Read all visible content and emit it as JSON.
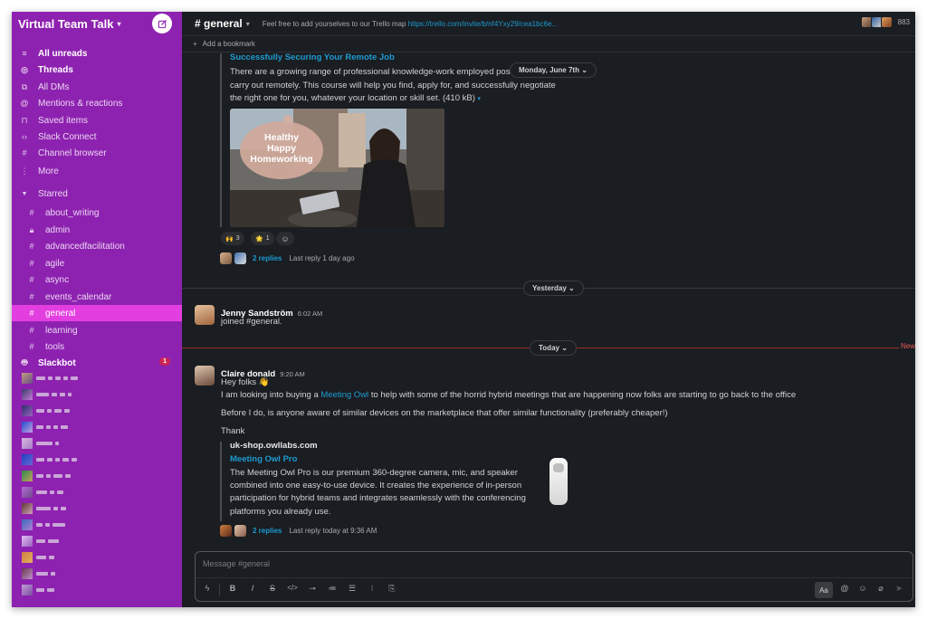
{
  "workspace": {
    "name": "Virtual Team Talk"
  },
  "sidebar": {
    "nav": [
      {
        "label": "All unreads",
        "icon": "unreads-icon",
        "bold": true
      },
      {
        "label": "Threads",
        "icon": "threads-icon",
        "bold": true
      },
      {
        "label": "All DMs",
        "icon": "dms-icon",
        "bold": false
      },
      {
        "label": "Mentions & reactions",
        "icon": "at-icon",
        "bold": false
      },
      {
        "label": "Saved items",
        "icon": "bookmark-icon",
        "bold": false
      },
      {
        "label": "Slack Connect",
        "icon": "connect-icon",
        "bold": false
      },
      {
        "label": "Channel browser",
        "icon": "channel-browser-icon",
        "bold": false
      },
      {
        "label": "More",
        "icon": "more-icon",
        "bold": false
      }
    ],
    "starred_label": "Starred",
    "channels": [
      {
        "name": "about_writing",
        "icon": "#"
      },
      {
        "name": "admin",
        "icon": "lock"
      },
      {
        "name": "advancedfacilitation",
        "icon": "#"
      },
      {
        "name": "agile",
        "icon": "#"
      },
      {
        "name": "async",
        "icon": "#"
      },
      {
        "name": "events_calendar",
        "icon": "#"
      },
      {
        "name": "general",
        "icon": "#",
        "active": true
      },
      {
        "name": "learning",
        "icon": "#"
      },
      {
        "name": "tools",
        "icon": "#"
      }
    ],
    "slackbot": {
      "name": "Slackbot",
      "badge": "1"
    }
  },
  "header": {
    "channel": "# general",
    "topic_prefix": "Feel free to add yourselves to our Trello map",
    "topic_link": "https://trello.com/invite/b/nf4Yxy29/cea1bc6e...",
    "member_count": "883",
    "bookmark": "Add a bookmark"
  },
  "messages": {
    "article": {
      "title": "Successfully Securing Your Remote Job",
      "text1": "There are a growing range of professional knowledge-work employed pos",
      "text2": "carry out remotely. This course will help you find, apply for, and successfully negotiate",
      "text3": "the right one for you, whatever your location or skill set. (410 kB)",
      "image_text": [
        "Healthy",
        "Happy",
        "Homeworking"
      ],
      "reactions": [
        {
          "emoji": "🙌",
          "count": "3"
        },
        {
          "emoji": "🌟",
          "count": "1"
        }
      ],
      "replies": "2 replies",
      "last_reply": "Last reply 1 day ago"
    },
    "date_pill_1": "Monday, June 7th",
    "date_pill_2": "Yesterday",
    "date_pill_3": "Today",
    "new_label": "New",
    "jenny": {
      "name": "Jenny Sandström",
      "time": "6:02 AM",
      "text": "joined #general."
    },
    "claire": {
      "name": "Claire donald",
      "time": "9:20 AM",
      "line1": "Hey folks 👋",
      "line2_pre": "I am looking into buying a ",
      "line2_link": "Meeting Owl",
      "line2_post": " to help with some of the horrid hybrid meetings that are happening now folks are starting to go back to the office",
      "line3": "Before I do, is anyone aware of similar devices on the marketplace that offer similar functionality (preferably cheaper!)",
      "line4": "Thank",
      "unfurl": {
        "site": "uk-shop.owllabs.com",
        "title": "Meeting Owl Pro",
        "d1": "The Meeting Owl Pro is our premium 360-degree camera, mic, and speaker",
        "d2": "combined into one easy-to-use device. It creates the experience of in-person",
        "d3": "participation for hybrid teams and integrates seamlessly with the conferencing",
        "d4": "platforms you already use."
      },
      "replies": "2 replies",
      "last_reply": "Last reply today at 9:36 AM"
    }
  },
  "composer": {
    "placeholder": "Message #general",
    "format_label": "Aa"
  },
  "colors": {
    "sidebar": "#8e22b0",
    "active": "#e33fe0",
    "link": "#1d9bd1",
    "background": "#1a1d21"
  }
}
